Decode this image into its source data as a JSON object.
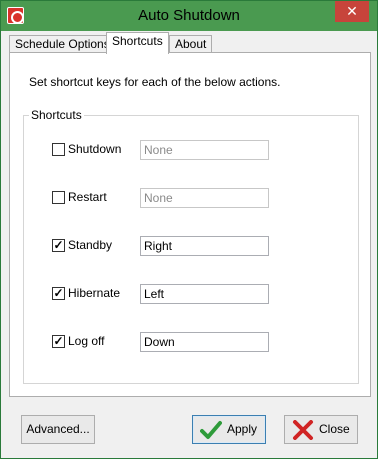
{
  "window": {
    "title": "Auto Shutdown",
    "close_glyph": "✕"
  },
  "tabs": [
    {
      "label": "Schedule Options"
    },
    {
      "label": "Shortcuts"
    },
    {
      "label": "About"
    }
  ],
  "description": "Set shortcut keys for each of the below actions.",
  "group": {
    "title": "Shortcuts",
    "rows": [
      {
        "label": "Shutdown",
        "checked": false,
        "value": "None"
      },
      {
        "label": "Restart",
        "checked": false,
        "value": "None"
      },
      {
        "label": "Standby",
        "checked": true,
        "value": "Right"
      },
      {
        "label": "Hibernate",
        "checked": true,
        "value": "Left"
      },
      {
        "label": "Log off",
        "checked": true,
        "value": "Down"
      }
    ]
  },
  "buttons": {
    "advanced": "Advanced...",
    "apply": "Apply",
    "close": "Close"
  },
  "colors": {
    "titlebar": "#4a9a50",
    "apply_icon": "#2e9b3a",
    "close_icon": "#d02424"
  },
  "icons": {
    "app": "shutdown-icon",
    "apply": "checkmark-icon",
    "close": "cross-icon"
  }
}
